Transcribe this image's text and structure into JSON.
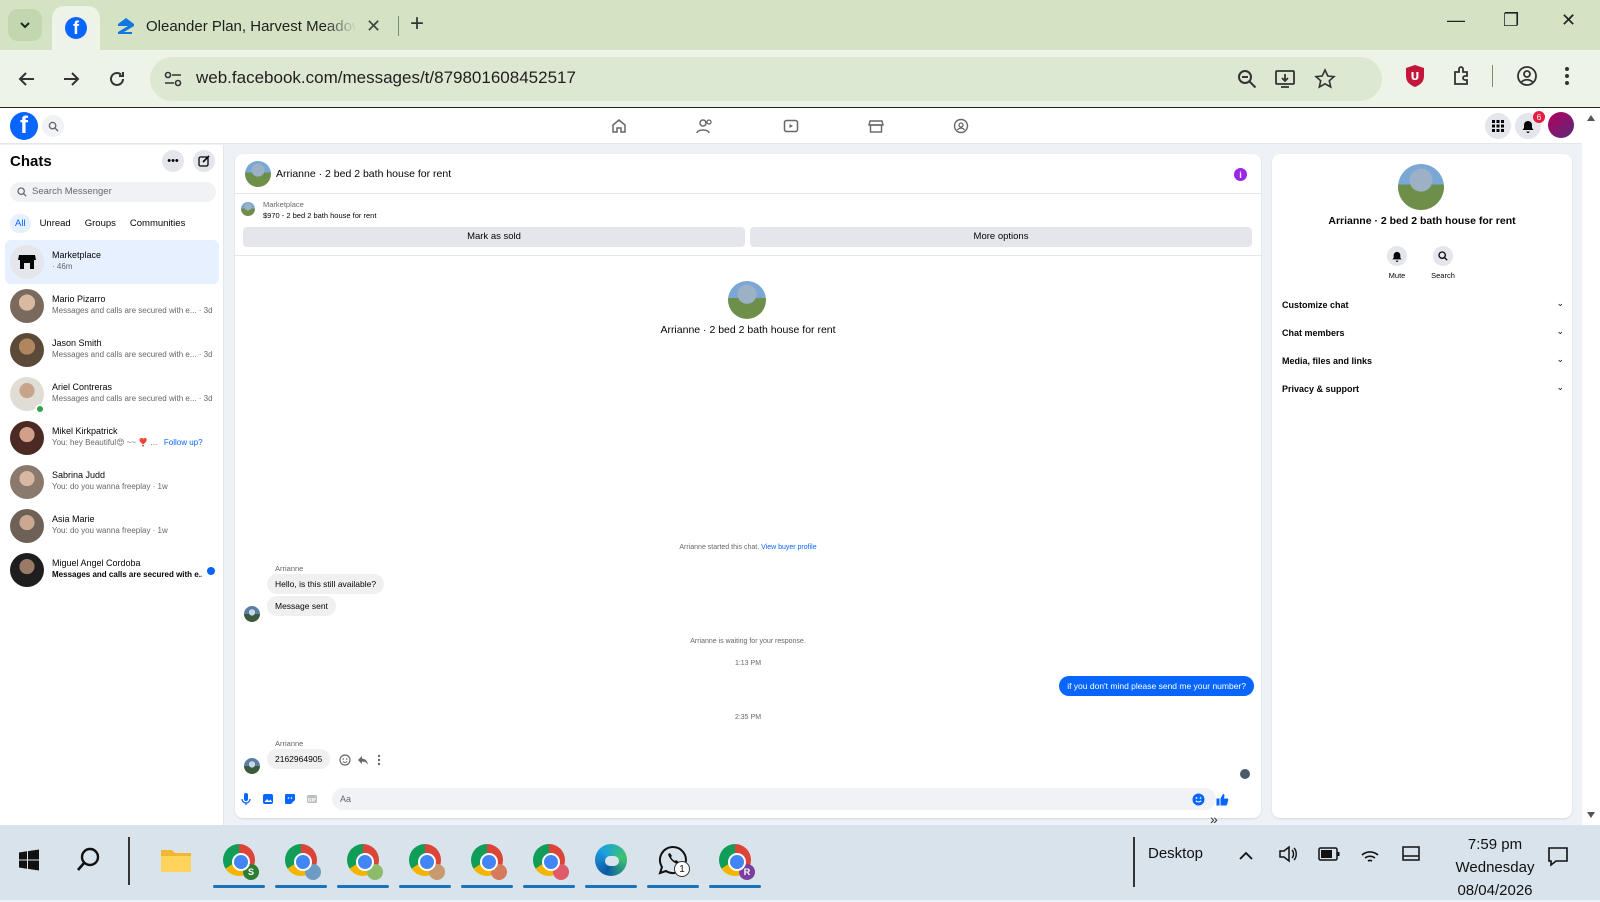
{
  "browser": {
    "tab_title": "Oleander Plan, Harvest Meadows",
    "url": "web.facebook.com/messages/t/879801608452517",
    "new_tab": "+",
    "minimize": "—",
    "restore": "❐",
    "close": "✕"
  },
  "facebook": {
    "notif_count": "6",
    "sidebar": {
      "title": "Chats",
      "search_placeholder": "Search Messenger",
      "filters": [
        "All",
        "Unread",
        "Groups",
        "Communities"
      ],
      "chats": [
        {
          "name": "Marketplace",
          "preview": "· 46m"
        },
        {
          "name": "Mario Pizarro",
          "preview": "Messages and calls are secured with e... · 3d"
        },
        {
          "name": "Jason Smith",
          "preview": "Messages and calls are secured with e... · 3d"
        },
        {
          "name": "Ariel Contreras",
          "preview": "Messages and calls are secured with e... · 3d"
        },
        {
          "name": "Mikel Kirkpatrick",
          "preview": "You: hey Beautiful😍 ~~ ❣️ ...",
          "extra": "Follow up?"
        },
        {
          "name": "Sabrina Judd",
          "preview": "You: do you wanna freeplay · 1w"
        },
        {
          "name": "Asia Marie",
          "preview": "You: do you wanna freeplay · 1w"
        },
        {
          "name": "Miguel Angel Cordoba",
          "preview": "Messages and calls are secured with e..."
        }
      ]
    },
    "conversation": {
      "title": "Arrianne · 2 bed 2 bath house for rent",
      "marketplace_label": "Marketplace",
      "listing": "$970 - 2 bed 2 bath house for rent",
      "mark_sold": "Mark as sold",
      "more_options": "More options",
      "hero_title": "Arrianne · 2 bed 2 bath house for rent",
      "started_text": "Arrianne started this chat.",
      "view_profile": "View buyer profile",
      "sender_name": "Arrianne",
      "msg1": "Hello, is this still available?",
      "msg2": "Message sent",
      "waiting": "Arrianne is waiting for your response.",
      "time1": "1:13 PM",
      "my_msg": "if you don't mind please send me your number?",
      "time2": "2:35 PM",
      "msg3": "2162964905",
      "composer_placeholder": "Aa"
    },
    "details": {
      "title": "Arrianne · 2 bed 2 bath house for rent",
      "mute": "Mute",
      "search": "Search",
      "sections": [
        "Customize chat",
        "Chat members",
        "Media, files and links",
        "Privacy & support"
      ]
    }
  },
  "taskbar": {
    "desktop_label": "Desktop",
    "time": "7:59 pm",
    "day": "Wednesday",
    "date": "08/04/2026",
    "whatsapp_badge": "1",
    "profiles": [
      "S",
      "",
      "",
      "",
      "",
      "",
      "R"
    ]
  }
}
